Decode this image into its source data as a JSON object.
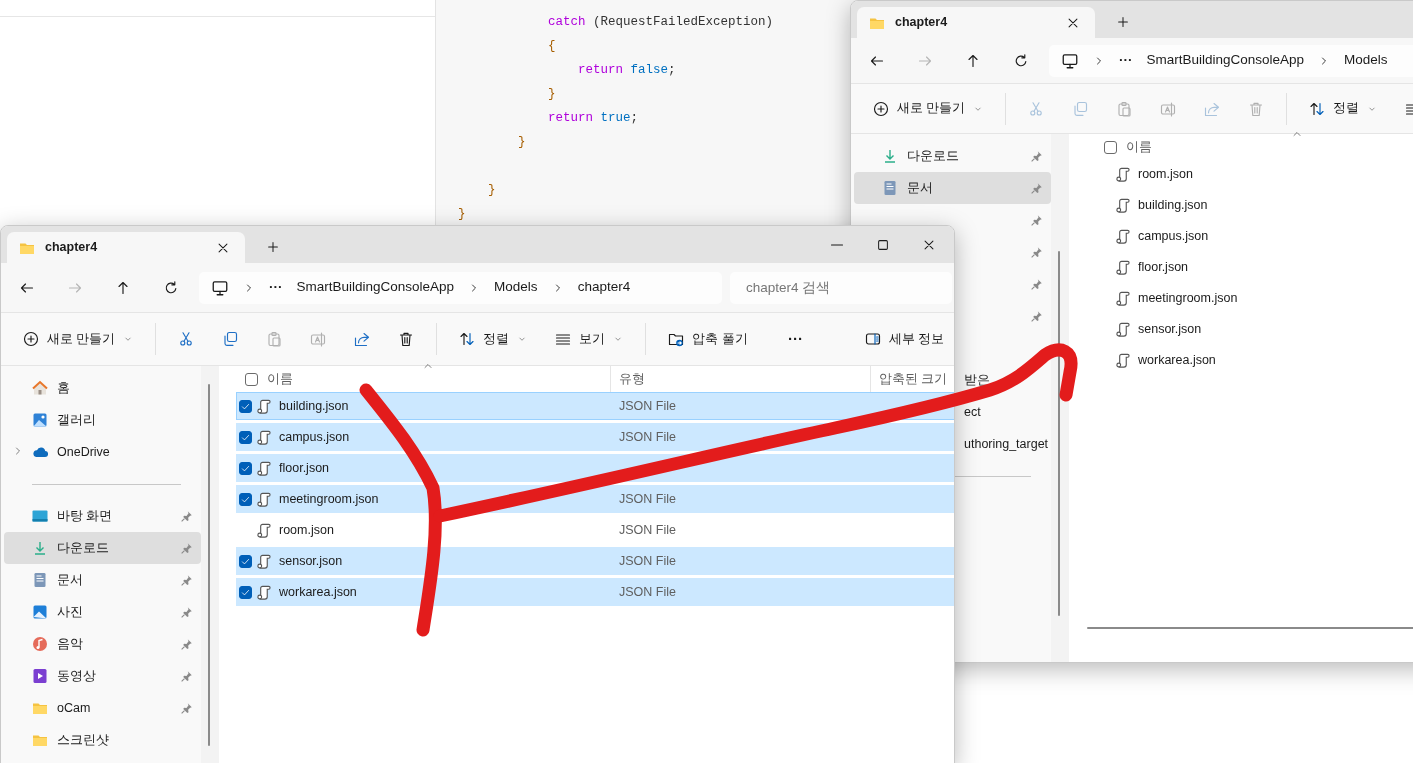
{
  "editor": {
    "lines": [
      {
        "tokens": [
          {
            "kind": "keyword",
            "text": "            catch"
          },
          {
            "kind": "plain",
            "text": " (RequestFailedException)"
          }
        ]
      },
      {
        "tokens": [
          {
            "kind": "brace",
            "text": "            {"
          }
        ]
      },
      {
        "tokens": [
          {
            "kind": "keyword",
            "text": "                return"
          },
          {
            "kind": "literal",
            "text": " false"
          },
          {
            "kind": "plain",
            "text": ";"
          }
        ]
      },
      {
        "tokens": [
          {
            "kind": "brace",
            "text": "            }"
          }
        ]
      },
      {
        "tokens": [
          {
            "kind": "keyword",
            "text": "            return"
          },
          {
            "kind": "literal",
            "text": " true"
          },
          {
            "kind": "plain",
            "text": ";"
          }
        ]
      },
      {
        "tokens": [
          {
            "kind": "brace",
            "text": "        }"
          }
        ]
      },
      {
        "blank": true
      },
      {
        "tokens": [
          {
            "kind": "brace",
            "text": "    }"
          }
        ]
      },
      {
        "tokens": [
          {
            "kind": "brace",
            "text": "}"
          }
        ]
      }
    ]
  },
  "right_window": {
    "tab": {
      "title": "chapter4"
    },
    "nav": [
      {
        "kind": "back",
        "disabled": false
      },
      {
        "kind": "forward",
        "disabled": true
      },
      {
        "kind": "up",
        "disabled": false
      },
      {
        "kind": "refresh",
        "disabled": false
      }
    ],
    "address": {
      "overflow": "···",
      "segments": [
        "SmartBuildingConsoleApp",
        "Models"
      ]
    },
    "commands": [
      {
        "kind": "new",
        "label": "새로 만들기",
        "dropdown": true,
        "disabled": false
      },
      {
        "kind": "divider"
      },
      {
        "kind": "cut",
        "disabled": true
      },
      {
        "kind": "copy",
        "disabled": true
      },
      {
        "kind": "paste",
        "disabled": true
      },
      {
        "kind": "rename",
        "disabled": true
      },
      {
        "kind": "share",
        "disabled": true
      },
      {
        "kind": "delete",
        "disabled": true
      },
      {
        "kind": "divider"
      },
      {
        "kind": "sort",
        "label": "정렬",
        "dropdown": true,
        "disabled": false
      },
      {
        "kind": "view",
        "disabled": false
      }
    ],
    "sidebar": [
      {
        "kind": "download",
        "label": "다운로드",
        "pinned": true,
        "selected": false
      },
      {
        "kind": "document",
        "label": "문서",
        "pinned": true,
        "selected": true
      },
      {
        "kind": "hidden",
        "pinned": true,
        "selected": false
      },
      {
        "kind": "hidden",
        "pinned": true,
        "selected": false
      },
      {
        "kind": "hidden",
        "pinned": true,
        "selected": false
      },
      {
        "kind": "hidden",
        "pinned": true,
        "selected": false
      },
      {
        "kind": "hidden",
        "pinned": false,
        "selected": false
      },
      {
        "kind": "partial",
        "label": "받은",
        "selected": false
      },
      {
        "kind": "partial",
        "label": "ect",
        "selected": false
      },
      {
        "kind": "partial",
        "label": "uthoring_target",
        "selected": false
      },
      {
        "kind": "divider"
      }
    ],
    "header": {
      "label": "이름",
      "checked": false
    },
    "files": [
      {
        "name": "room.json",
        "selected": false
      },
      {
        "name": "building.json",
        "selected": false
      },
      {
        "name": "campus.json",
        "selected": false
      },
      {
        "name": "floor.json",
        "selected": false
      },
      {
        "name": "meetingroom.json",
        "selected": false
      },
      {
        "name": "sensor.json",
        "selected": false
      },
      {
        "name": "workarea.json",
        "selected": false
      }
    ]
  },
  "left_window": {
    "tab": {
      "title": "chapter4"
    },
    "nav": [
      {
        "kind": "back",
        "disabled": false
      },
      {
        "kind": "forward",
        "disabled": true
      },
      {
        "kind": "up",
        "disabled": false
      },
      {
        "kind": "refresh",
        "disabled": false
      }
    ],
    "address": {
      "overflow": "···",
      "segments": [
        "SmartBuildingConsoleApp",
        "Models",
        "chapter4"
      ]
    },
    "search": {
      "placeholder": "chapter4 검색"
    },
    "commands": [
      {
        "kind": "new",
        "label": "새로 만들기",
        "dropdown": true,
        "disabled": false
      },
      {
        "kind": "divider"
      },
      {
        "kind": "cut",
        "disabled": false
      },
      {
        "kind": "copy",
        "disabled": false
      },
      {
        "kind": "paste",
        "disabled": true
      },
      {
        "kind": "rename",
        "disabled": true
      },
      {
        "kind": "share",
        "disabled": false
      },
      {
        "kind": "delete",
        "disabled": false
      },
      {
        "kind": "divider"
      },
      {
        "kind": "sort",
        "label": "정렬",
        "dropdown": true,
        "disabled": false
      },
      {
        "kind": "view",
        "label": "보기",
        "dropdown": true,
        "disabled": false
      },
      {
        "kind": "divider"
      },
      {
        "kind": "extract",
        "label": "압축 풀기",
        "dropdown": false,
        "disabled": false
      },
      {
        "kind": "more",
        "label": "···",
        "dropdown": false,
        "disabled": false
      },
      {
        "kind": "details",
        "label": "세부 정보",
        "dropdown": false,
        "disabled": false
      }
    ],
    "sidebar": [
      {
        "kind": "home",
        "label": "홈",
        "pinned": false,
        "selected": false
      },
      {
        "kind": "gallery",
        "label": "갤러리",
        "pinned": false,
        "selected": false
      },
      {
        "kind": "cloud",
        "label": "OneDrive",
        "pinned": false,
        "selected": false,
        "expanded": false
      },
      {
        "kind": "divider"
      },
      {
        "kind": "desktop",
        "label": "바탕 화면",
        "pinned": true,
        "selected": false
      },
      {
        "kind": "download",
        "label": "다운로드",
        "pinned": true,
        "selected": true
      },
      {
        "kind": "document",
        "label": "문서",
        "pinned": true,
        "selected": false
      },
      {
        "kind": "photo",
        "label": "사진",
        "pinned": true,
        "selected": false
      },
      {
        "kind": "music",
        "label": "음악",
        "pinned": true,
        "selected": false
      },
      {
        "kind": "video",
        "label": "동영상",
        "pinned": true,
        "selected": false
      },
      {
        "kind": "folder",
        "label": "oCam",
        "pinned": true,
        "selected": false
      },
      {
        "kind": "folder",
        "label": "스크린샷",
        "pinned": false,
        "selected": false
      }
    ],
    "columns": [
      "이름",
      "유형",
      "압축된 크기"
    ],
    "header": {
      "checked": false
    },
    "files": [
      {
        "name": "building.json",
        "type": "JSON File",
        "selected": true
      },
      {
        "name": "campus.json",
        "type": "JSON File",
        "selected": true
      },
      {
        "name": "floor.json",
        "selected": true
      },
      {
        "name": "meetingroom.json",
        "type": "JSON File",
        "selected": true
      },
      {
        "name": "room.json",
        "type": "JSON File",
        "selected": false
      },
      {
        "name": "sensor.json",
        "type": "JSON File",
        "selected": true
      },
      {
        "name": "workarea.json",
        "type": "JSON File",
        "selected": true
      }
    ]
  }
}
